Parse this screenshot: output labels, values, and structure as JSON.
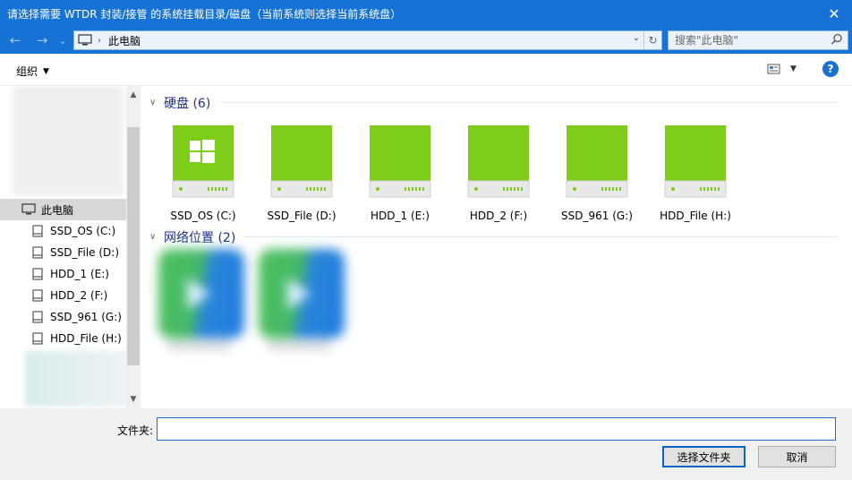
{
  "window": {
    "title": "请选择需要 WTDR 封装/接管 的系统挂载目录/磁盘（当前系统则选择当前系统盘）",
    "close_glyph": "✕"
  },
  "nav": {
    "back_glyph": "←",
    "forward_glyph": "→",
    "recent_glyph": "⌄",
    "address_icon": "pc-icon",
    "address_path": "此电脑",
    "refresh_glyph": "↻",
    "search_placeholder": "搜索\"此电脑\""
  },
  "toolbar": {
    "organize_label": "组织",
    "help_label": "?"
  },
  "sidebar": {
    "this_pc": "此电脑",
    "items": [
      {
        "label": "SSD_OS (C:)"
      },
      {
        "label": "SSD_File (D:)"
      },
      {
        "label": "HDD_1 (E:)"
      },
      {
        "label": "HDD_2 (F:)"
      },
      {
        "label": "SSD_961 (G:)"
      },
      {
        "label": "HDD_File (H:)"
      }
    ]
  },
  "main": {
    "drives_group": "硬盘 (6)",
    "network_group": "网络位置 (2)",
    "drives": [
      {
        "label": "SSD_OS (C:)",
        "windows_logo": true
      },
      {
        "label": "SSD_File (D:)",
        "windows_logo": false
      },
      {
        "label": "HDD_1 (E:)",
        "windows_logo": false
      },
      {
        "label": "HDD_2 (F:)",
        "windows_logo": false
      },
      {
        "label": "SSD_961 (G:)",
        "windows_logo": false
      },
      {
        "label": "HDD_File (H:)",
        "windows_logo": false
      }
    ]
  },
  "footer": {
    "folder_label": "文件夹:",
    "folder_value": "",
    "select_button": "选择文件夹",
    "cancel_button": "取消"
  },
  "colors": {
    "titlebar": "#1672d4",
    "drive_green": "#7dcd1a",
    "group_heading": "#1e3287",
    "accent": "#1a6fd0"
  }
}
